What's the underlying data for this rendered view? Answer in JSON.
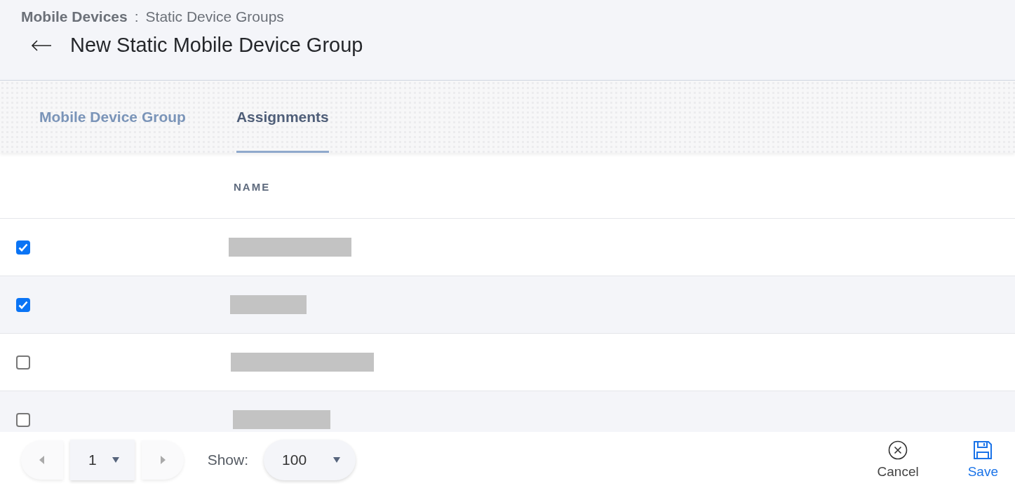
{
  "breadcrumb": {
    "section": "Mobile Devices",
    "separator": ":",
    "page": "Static Device Groups"
  },
  "title": "New Static Mobile Device Group",
  "tabs": [
    {
      "label": "Mobile Device Group",
      "selected": false
    },
    {
      "label": "Assignments",
      "selected": true
    }
  ],
  "table": {
    "columns": [
      "NAME"
    ],
    "rows": [
      {
        "checked": true,
        "kind": "redacted"
      },
      {
        "checked": true,
        "kind": "redacted"
      },
      {
        "checked": false,
        "kind": "redacted"
      },
      {
        "checked": false,
        "kind": "redacted"
      }
    ]
  },
  "pagination": {
    "page": "1",
    "show_label": "Show:",
    "page_size": "100"
  },
  "actions": [
    {
      "label": "Cancel",
      "kind": "cancel"
    },
    {
      "label": "Save",
      "kind": "save"
    }
  ]
}
